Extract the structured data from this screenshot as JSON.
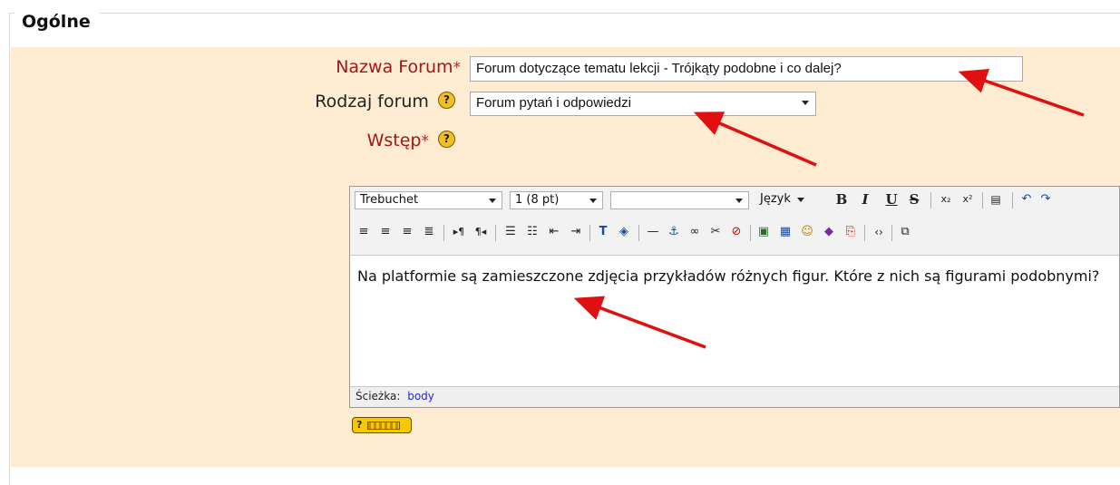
{
  "legend": "Ogólne",
  "fields": {
    "name": {
      "label": "Nazwa Forum",
      "required_mark": "*",
      "value": "Forum dotyczące tematu lekcji - Trójkąty podobne i co dalej?"
    },
    "type": {
      "label": "Rodzaj forum",
      "value": "Forum pytań i odpowiedzi"
    },
    "intro": {
      "label": "Wstęp",
      "required_mark": "*"
    }
  },
  "editor": {
    "font": "Trebuchet",
    "size": "1 (8 pt)",
    "format": "",
    "language": "Język",
    "content": "Na platformie są zamieszczone zdjęcia przykładów różnych figur. Które z nich są figurami podobnymi?",
    "path_label": "Ścieżka:",
    "path_value": "body"
  },
  "toolbar_row1_icons": [
    "bold-icon",
    "italic-icon",
    "underline-icon",
    "strikethrough-icon",
    "subscript-icon",
    "superscript-icon",
    "paste-word-icon",
    "undo-icon",
    "redo-icon"
  ],
  "toolbar_row2_icons": [
    "align-left-icon",
    "align-center-icon",
    "align-right-icon",
    "justify-icon",
    "ltr-icon",
    "rtl-icon",
    "ordered-list-icon",
    "unordered-list-icon",
    "outdent-icon",
    "indent-icon",
    "text-color-icon",
    "bg-color-icon",
    "horizontal-rule-icon",
    "anchor-icon",
    "link-icon",
    "unlink-icon",
    "nolink-icon",
    "image-icon",
    "table-icon",
    "smiley-icon",
    "special-char-icon",
    "search-replace-icon",
    "html-source-icon",
    "fullscreen-icon"
  ],
  "help_icon_glyph": "?",
  "colors": {
    "band": "#feecd2",
    "required_label": "#a01818",
    "arrow": "#e01010"
  }
}
